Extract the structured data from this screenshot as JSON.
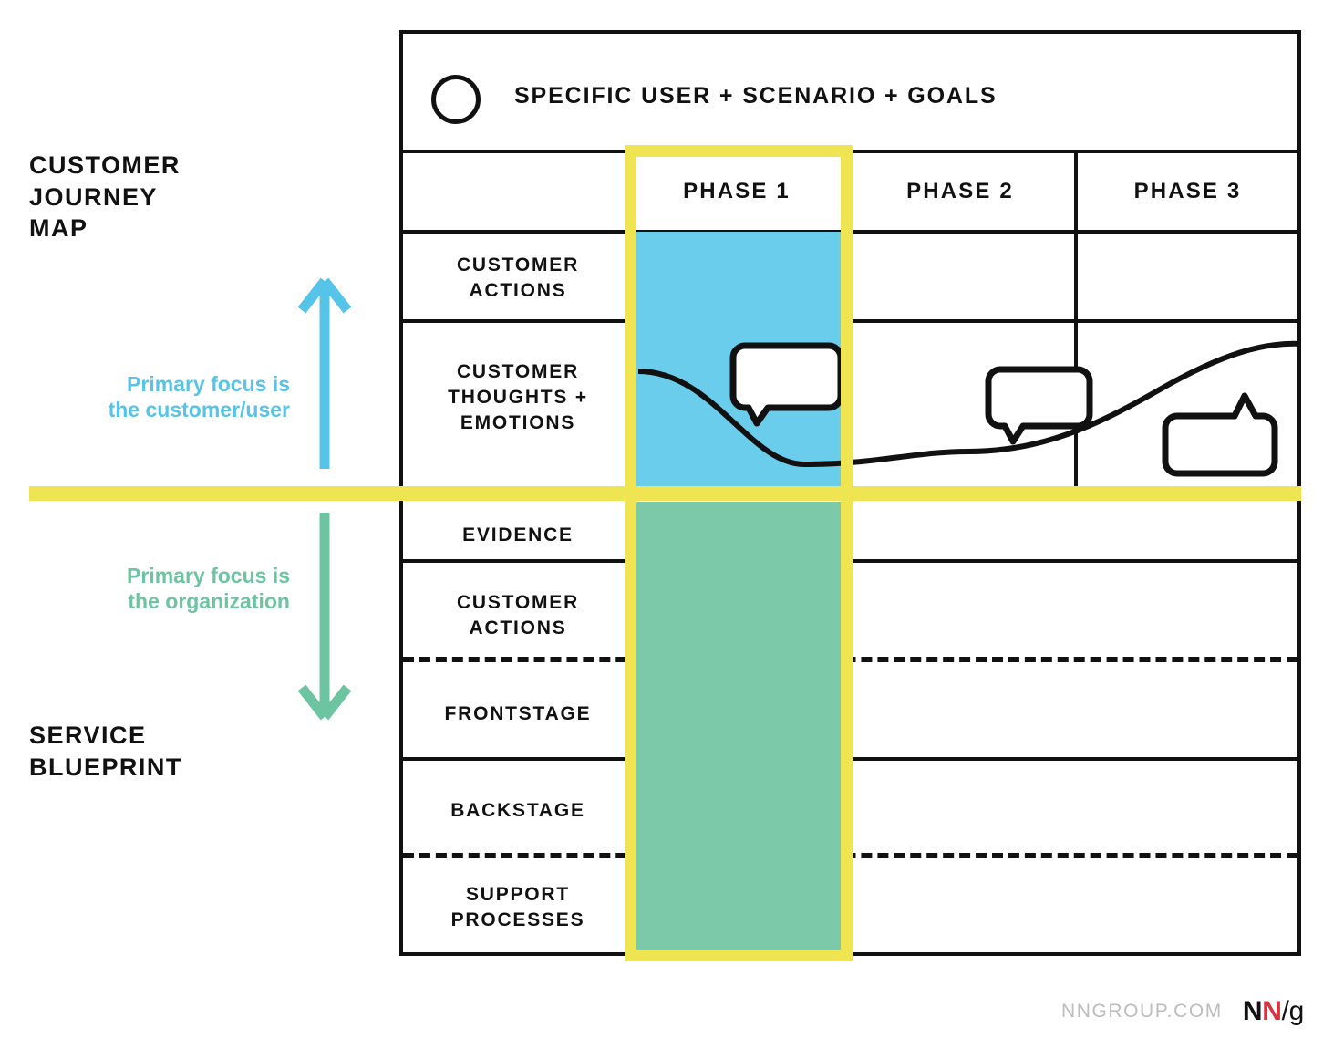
{
  "side_labels": {
    "journey_map_title": "CUSTOMER\nJOURNEY\nMAP",
    "service_blueprint_title": "SERVICE\nBLUEPRINT",
    "focus_upper": "Primary focus is\nthe customer/user",
    "focus_lower": "Primary focus is\nthe organization"
  },
  "header": {
    "persona_label": "SPECIFIC USER + SCENARIO + GOALS",
    "persona_icon": "circle-avatar-icon"
  },
  "phases": [
    {
      "label": "PHASE 1",
      "highlighted": true
    },
    {
      "label": "PHASE 2",
      "highlighted": false
    },
    {
      "label": "PHASE 3",
      "highlighted": false
    }
  ],
  "upper_rows": [
    {
      "label": "CUSTOMER\nACTIONS"
    },
    {
      "label": "CUSTOMER\nTHOUGHTS +\nEMOTIONS"
    }
  ],
  "lower_rows": [
    {
      "label": "EVIDENCE",
      "divider_below": "solid"
    },
    {
      "label": "CUSTOMER\nACTIONS",
      "divider_below": "dashed"
    },
    {
      "label": "FRONTSTAGE",
      "divider_below": "solid"
    },
    {
      "label": "BACKSTAGE",
      "divider_below": "dashed"
    },
    {
      "label": "SUPPORT\nPROCESSES",
      "divider_below": "none"
    }
  ],
  "annotations": {
    "emotion_curve_name": "emotion-curve",
    "bubbles": [
      {
        "name": "thought-bubble-phase-1",
        "tail": "bottom-left"
      },
      {
        "name": "thought-bubble-phase-2",
        "tail": "bottom-left"
      },
      {
        "name": "thought-bubble-phase-3",
        "tail": "top-right"
      }
    ]
  },
  "colors": {
    "highlight_yellow": "#efe451",
    "customer_blue": "#6bcdec",
    "organization_green": "#7cc9a9",
    "ink": "#111111",
    "logo_red": "#d9333f",
    "footer_gray": "#bdbdbd"
  },
  "footer": {
    "url": "NNGROUP.COM",
    "logo_n1": "N",
    "logo_n2": "N",
    "logo_slash": "/",
    "logo_g": "g"
  }
}
